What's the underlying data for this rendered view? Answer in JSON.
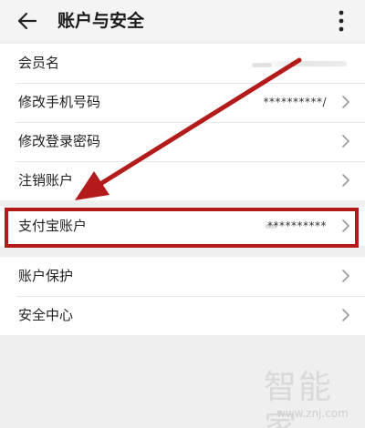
{
  "header": {
    "title": "账户与安全",
    "back_icon": "back-arrow-icon",
    "more_icon": "more-vertical-icon"
  },
  "group1": [
    {
      "label": "会员名",
      "value": ""
    },
    {
      "label": "修改手机号码",
      "value": "**********/"
    },
    {
      "label": "修改登录密码",
      "value": ""
    },
    {
      "label": "注销账户",
      "value": ""
    }
  ],
  "group2": [
    {
      "label": "支付宝账户",
      "value": "**********"
    }
  ],
  "group3": [
    {
      "label": "账户保护",
      "value": ""
    },
    {
      "label": "安全中心",
      "value": ""
    }
  ],
  "watermark": {
    "text": "智能家",
    "url": "www.znj.com"
  },
  "colors": {
    "highlight": "#b31b1b",
    "background": "#efefef",
    "row_background": "#ffffff"
  }
}
